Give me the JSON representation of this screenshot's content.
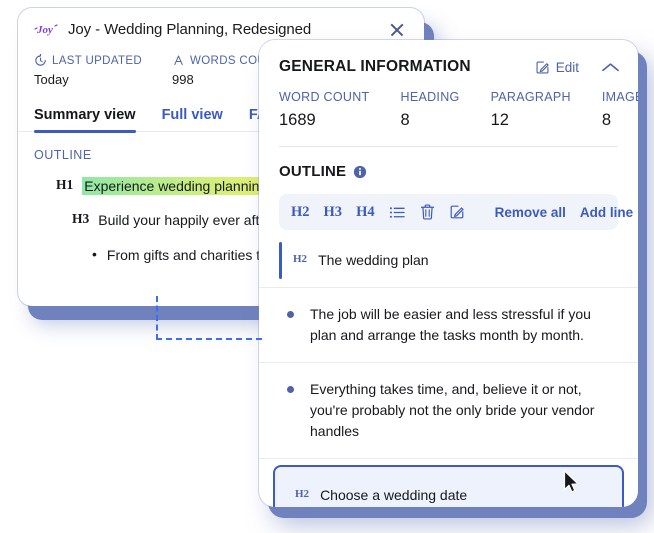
{
  "doc_window": {
    "logo_icon": "joy-logo-icon",
    "title": "Joy - Wedding Planning, Redesigned",
    "close_icon": "close-icon",
    "stats": [
      {
        "icon": "clock-icon",
        "label": "LAST UPDATED",
        "value": "Today"
      },
      {
        "icon": "font-size-icon",
        "label": "WORDS COUNT",
        "value": "998"
      }
    ],
    "tabs": [
      {
        "label": "Summary view",
        "active": true
      },
      {
        "label": "Full view",
        "active": false
      },
      {
        "label": "FAQs",
        "active": false
      }
    ],
    "outline_label": "OUTLINE",
    "outline_rows": [
      {
        "tag": "H1",
        "text": "Experience wedding planning t",
        "highlighted": true,
        "level": "lvl1"
      },
      {
        "tag": "H3",
        "text": "Build your happily ever after",
        "highlighted": false,
        "level": "lvl3"
      },
      {
        "tag": "",
        "text": "From gifts and charities to c experiences",
        "highlighted": false,
        "level": "bullet"
      }
    ]
  },
  "info_panel": {
    "title": "GENERAL INFORMATION",
    "edit_label": "Edit",
    "edit_icon": "edit-pencil-icon",
    "collapse_icon": "chevron-up-icon",
    "stats": [
      {
        "label": "WORD COUNT",
        "value": "1689"
      },
      {
        "label": "HEADING",
        "value": "8"
      },
      {
        "label": "PARAGRAPH",
        "value": "12"
      },
      {
        "label": "IMAGE",
        "value": "8"
      }
    ],
    "outline_title": "OUTLINE",
    "info_icon": "info-icon",
    "toolbar": {
      "h2_label": "H2",
      "h3_label": "H3",
      "h4_label": "H4",
      "list_icon": "bulleted-list-icon",
      "delete_icon": "trash-icon",
      "edit_icon": "edit-pencil-icon",
      "remove_all_label": "Remove all",
      "add_line_label": "Add line"
    },
    "items": [
      {
        "kind": "heading",
        "tag": "H2",
        "text": "The wedding plan",
        "selected": false
      },
      {
        "kind": "bullet",
        "tag": "",
        "text": "The job will be easier and less stressful if you plan and arrange the tasks month by month.",
        "selected": false
      },
      {
        "kind": "bullet",
        "tag": "",
        "text": "Everything takes time, and, believe it or not, you're probably not the only bride your vendor handles",
        "selected": false
      },
      {
        "kind": "heading",
        "tag": "H2",
        "text": "Choose a wedding date",
        "selected": true
      }
    ]
  },
  "cursor": {
    "icon": "mouse-pointer-icon"
  },
  "colors": {
    "accent": "#3b5bc0",
    "muted_blue": "#4e63a8",
    "shadow_blue": "#7082bd",
    "toolbar_bg": "#f1f3fa",
    "selected_bg": "#eef2fd",
    "guide_line": "#3b6ef0",
    "highlight_start": "#8fe8a6",
    "highlight_end": "#e4f06b"
  }
}
